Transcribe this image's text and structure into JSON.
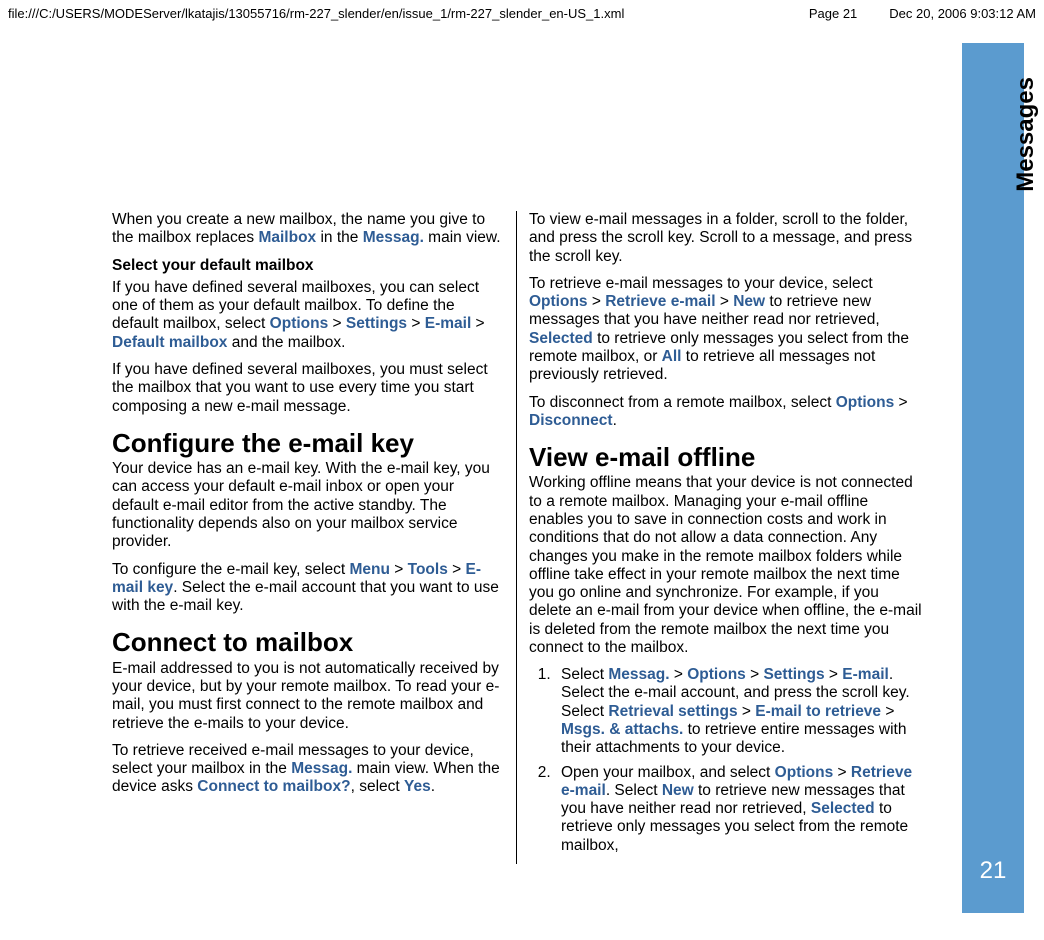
{
  "header": {
    "path": "file:///C:/USERS/MODEServer/lkatajis/13055716/rm-227_slender/en/issue_1/rm-227_slender_en-US_1.xml",
    "page": "Page 21",
    "date": "Dec 20, 2006 9:03:12 AM"
  },
  "side": {
    "section": "Messages",
    "pageNumber": "21"
  },
  "left": {
    "p1_a": "When you create a new mailbox, the name you give to the mailbox replaces ",
    "p1_ui1": "Mailbox",
    "p1_b": " in the ",
    "p1_ui2": "Messag.",
    "p1_c": " main view.",
    "subhead": "Select your default mailbox",
    "p2_a": "If you have defined several mailboxes, you can select one of them as your default mailbox. To define the default mailbox, select ",
    "p2_ui1": "Options",
    "gt": " > ",
    "p2_ui2": "Settings",
    "p2_ui3": "E-mail",
    "p2_ui4": "Default mailbox",
    "p2_b": " and the mailbox.",
    "p3": "If you have defined several mailboxes, you must select the mailbox that you want to use every time you start composing a new e-mail message.",
    "h1": "Configure the e-mail key",
    "p4": "Your device has an e-mail key. With the e-mail key, you can access your default e-mail inbox or open your default e-mail editor from the active standby. The functionality depends also on your mailbox service provider.",
    "p5_a": "To configure the e-mail key, select ",
    "p5_ui1": "Menu",
    "p5_ui2": "Tools",
    "p5_ui3": "E-mail key",
    "p5_b": ". Select the e-mail account that you want to use with the e-mail key.",
    "h2": "Connect to mailbox",
    "p6": "E-mail addressed to you is not automatically received by your device, but by your remote mailbox. To read your e-mail, you must first connect to the remote mailbox and retrieve the e-mails to your device.",
    "p7_a": "To retrieve received e-mail messages to your device, select your mailbox in the ",
    "p7_ui1": "Messag.",
    "p7_b": " main view. When the device asks ",
    "p7_ui2": "Connect to mailbox?",
    "p7_c": ", select ",
    "p7_ui3": "Yes",
    "p7_d": "."
  },
  "right": {
    "p1": "To view e-mail messages in a folder, scroll to the folder, and press the scroll key. Scroll to a message, and press the scroll key.",
    "p2_a": "To retrieve e-mail messages to your device, select ",
    "p2_ui1": "Options",
    "gt": " > ",
    "p2_ui2": "Retrieve e-mail",
    "p2_ui3": "New",
    "p2_b": " to retrieve new messages that you have neither read nor retrieved, ",
    "p2_ui4": "Selected",
    "p2_c": " to retrieve only messages you select from the remote mailbox, or ",
    "p2_ui5": "All",
    "p2_d": " to retrieve all messages not previously retrieved.",
    "p3_a": "To disconnect from a remote mailbox, select ",
    "p3_ui1": "Options",
    "p3_ui2": "Disconnect",
    "p3_b": ".",
    "h1": "View e-mail offline",
    "p4": "Working offline means that your device is not connected to a remote mailbox. Managing your e-mail offline enables you to save in connection costs and work in conditions that do not allow a data connection. Any changes you make in the remote mailbox folders while offline take effect in your remote mailbox the next time you go online and synchronize. For example, if you delete an e-mail from your device when offline, the e-mail is deleted from the remote mailbox the next time you connect to the mailbox.",
    "li1_a": "Select ",
    "li1_ui1": "Messag.",
    "li1_ui2": "Options",
    "li1_ui3": "Settings",
    "li1_ui4": "E-mail",
    "li1_b": ". Select the e-mail account, and press the scroll key. Select ",
    "li1_ui5": "Retrieval settings",
    "li1_ui6": "E-mail to retrieve",
    "li1_ui7": "Msgs. & attachs.",
    "li1_c": " to retrieve entire messages with their attachments to your device.",
    "li2_a": "Open your mailbox, and select ",
    "li2_ui1": "Options",
    "li2_ui2": "Retrieve e-mail",
    "li2_b": ". Select ",
    "li2_ui3": "New",
    "li2_c": " to retrieve new messages that you have neither read nor retrieved, ",
    "li2_ui4": "Selected",
    "li2_d": " to retrieve only messages you select from the remote mailbox,"
  }
}
